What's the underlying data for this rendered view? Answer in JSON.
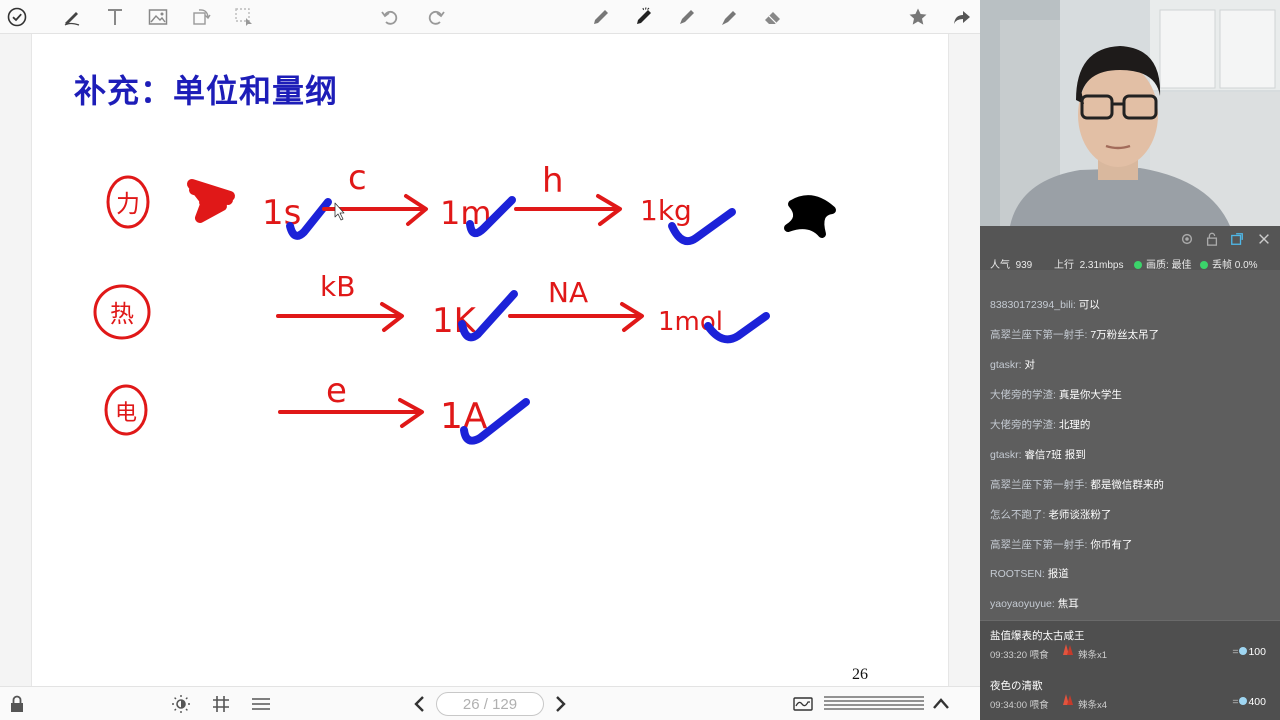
{
  "whiteboard": {
    "slide_title": "补充：单位和量纲",
    "page_number_corner": "26",
    "pager": {
      "current": "26",
      "total": "129",
      "text": "26 / 129"
    },
    "handwriting": {
      "row1": {
        "marker": "力",
        "from": "1s",
        "arrow1": "c",
        "mid": "1m",
        "arrow2": "h",
        "to": "1kg"
      },
      "row2": {
        "marker": "热",
        "arrow1": "kB",
        "mid": "1K",
        "arrow2": "NA",
        "to": "1mol"
      },
      "row3": {
        "marker": "电",
        "arrow1": "e",
        "to": "1A"
      }
    }
  },
  "toolbar": {
    "left": [
      "check-circle-icon",
      "pen-icon",
      "text-icon",
      "image-icon",
      "rotate-icon",
      "select-icon"
    ],
    "center": [
      "undo-icon",
      "redo-icon"
    ],
    "right": [
      "pencil-icon",
      "marker-icon",
      "brush-icon",
      "highlighter-icon",
      "eraser-icon"
    ],
    "far_right": [
      "star-icon",
      "share-icon"
    ]
  },
  "stream": {
    "popularity_label": "人气",
    "popularity": "939",
    "upload_label": "上行",
    "upload": "2.31mbps",
    "quality_label": "画质:",
    "quality": "最佳",
    "dropped_label": "丢帧",
    "dropped": "0.0%"
  },
  "chat": [
    {
      "user": "83830172394_bili",
      "text": "可以"
    },
    {
      "user": "高翠兰座下第一射手",
      "text": "7万粉丝太吊了"
    },
    {
      "user": "gtaskr",
      "text": "对"
    },
    {
      "user": "大佬旁的学渣",
      "text": "真是你大学生"
    },
    {
      "user": "大佬旁的学渣",
      "text": "北理的"
    },
    {
      "user": "gtaskr",
      "text": "睿信7班 报到"
    },
    {
      "user": "高翠兰座下第一射手",
      "text": "都是微信群来的"
    },
    {
      "user": "怎么不跑了",
      "text": "老师谈涨粉了"
    },
    {
      "user": "高翠兰座下第一射手",
      "text": "你币有了"
    },
    {
      "user": "ROOTSEN",
      "text": "报道"
    },
    {
      "user": "yaoyaoyuyue",
      "text": "焦耳"
    }
  ],
  "gifts": [
    {
      "name": "盐值爆表的太古咸王",
      "time": "09:33:20 喂食",
      "item": "辣条x1",
      "value": "100"
    },
    {
      "name": "夜色の清歌",
      "time": "09:34:00 喂食",
      "item": "辣条x4",
      "value": "400"
    }
  ],
  "colors": {
    "title": "#1d1db8",
    "red_ink": "#e01818",
    "blue_ink": "#1c22d8",
    "black_ink": "#000000"
  }
}
